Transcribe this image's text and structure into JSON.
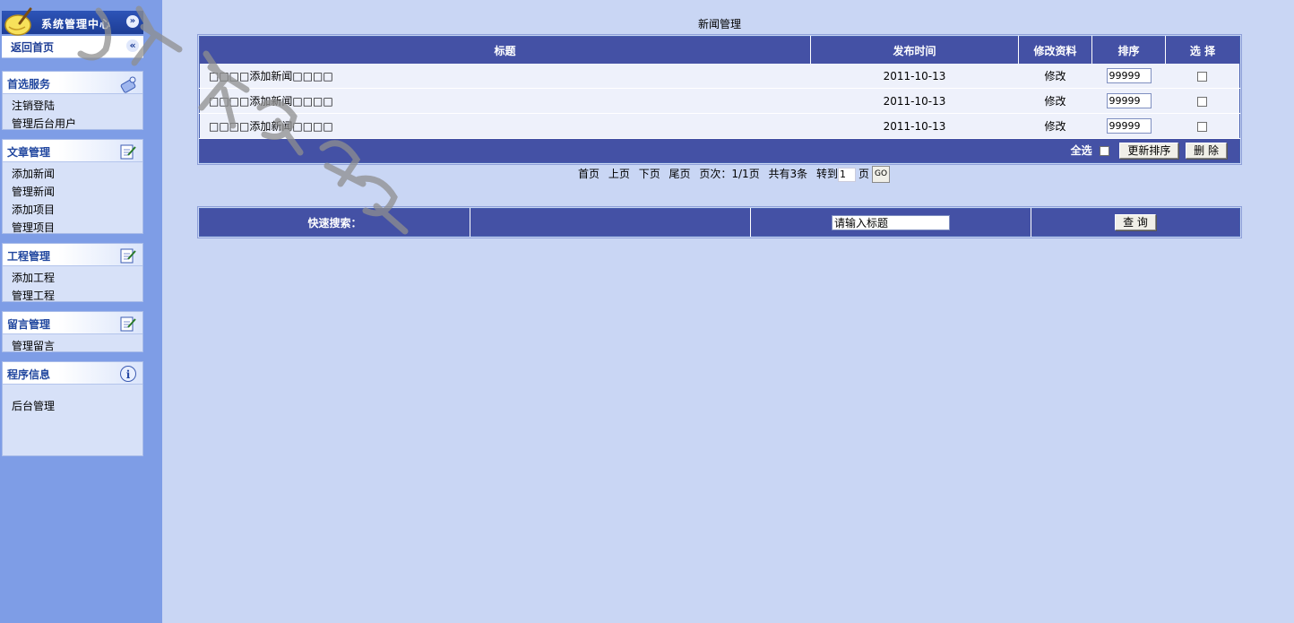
{
  "sidebar": {
    "title": "系统管理中心",
    "home": "返回首页",
    "panels": [
      {
        "title": "首选服务",
        "items": [
          "注销登陆",
          "管理后台用户"
        ]
      },
      {
        "title": "文章管理",
        "items": [
          "添加新闻",
          "管理新闻",
          "添加项目",
          "管理项目"
        ]
      },
      {
        "title": "工程管理",
        "items": [
          "添加工程",
          "管理工程"
        ]
      },
      {
        "title": "留言管理",
        "items": [
          "管理留言"
        ]
      },
      {
        "title": "程序信息",
        "items": [
          "后台管理"
        ]
      }
    ]
  },
  "page": {
    "title": "新闻管理"
  },
  "news_table": {
    "headers": [
      "标题",
      "发布时间",
      "修改资料",
      "排序",
      "选 择"
    ],
    "rows": [
      {
        "title": "□□□□添加新闻□□□□",
        "date": "2011-10-13",
        "edit": "修改",
        "sort": "99999"
      },
      {
        "title": "□□□□添加新闻□□□□",
        "date": "2011-10-13",
        "edit": "修改",
        "sort": "99999"
      },
      {
        "title": "□□□□添加新闻□□□□",
        "date": "2011-10-13",
        "edit": "修改",
        "sort": "99999"
      }
    ],
    "footer": {
      "select_all": "全选",
      "update_sort": "更新排序",
      "delete": "删 除"
    }
  },
  "pager": {
    "first": "首页",
    "prev": "上页",
    "next": "下页",
    "last": "尾页",
    "page_info": "页次：1/1页",
    "total": "共有3条",
    "goto": "转到",
    "page_value": "1",
    "page_unit": "页",
    "go": "GO"
  },
  "search": {
    "label": "快速搜索：",
    "input_value": "请输入标题",
    "button": "查 询"
  },
  "colors": {
    "accent": "#4451a5",
    "background": "#c9d6f4",
    "sidebar": "#7e9de6"
  }
}
